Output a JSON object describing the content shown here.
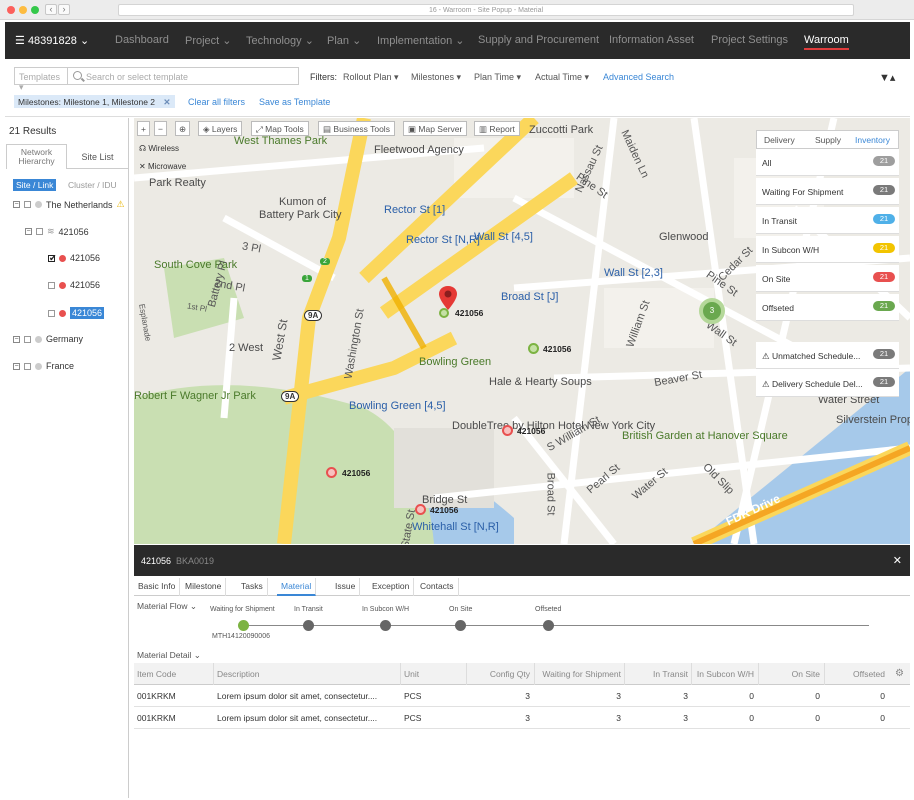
{
  "window": {
    "url_title": "16 - Warroom - Site Popup - Material"
  },
  "topnav": {
    "site_id": "48391828",
    "items": [
      "Dashboard",
      "Project",
      "Technology",
      "Plan",
      "Implementation",
      "Supply and Procurement",
      "Information Asset",
      "Project Settings",
      "Warroom"
    ],
    "active": "Warroom"
  },
  "filterbar": {
    "templates_placeholder": "Templates",
    "search_placeholder": "Search or select template",
    "filters_label": "Filters:",
    "filters": [
      "Rollout Plan",
      "Milestones",
      "Plan Time",
      "Actual Time"
    ],
    "advanced_search": "Advanced Search",
    "chip_label": "Milestones:",
    "chip_value": "Milestone 1, Milestone 2",
    "clear_all": "Clear all filters",
    "save_template": "Save as Template"
  },
  "sidebar": {
    "results": "21 Results",
    "tab_hierarchy": "Network Hierarchy",
    "tab_sitelist": "Site List",
    "seg_active": "Site / Link",
    "seg_other": "Cluster / IDU",
    "tree": {
      "netherlands": "The Netherlands",
      "node_a": "421056",
      "node_b": "421056",
      "node_c": "421056",
      "node_d": "421056",
      "germany": "Germany",
      "france": "France"
    }
  },
  "map": {
    "tools": [
      "Layers",
      "Map Tools",
      "Business Tools",
      "Map Server",
      "Report"
    ],
    "layer_wireless": "Wireless",
    "layer_microwave": "Microwave",
    "markers": {
      "main": "421056",
      "m2": "421056",
      "m3": "421056",
      "m4": "421056",
      "m5": "421056"
    },
    "cluster_count": "3",
    "streets": {
      "rector_st": "Rector St [1]",
      "rector_nr": "Rector St [N,R]",
      "wall_st45": "Wall St [4,5]",
      "wall_st23": "Wall St [2,3]",
      "broad_st_j": "Broad St [J]",
      "bowling_green": "Bowling Green [4,5]",
      "bowling_green_park": "Bowling Green",
      "battery_park": "Battery Park City",
      "kumon": "Kumon of",
      "fleetwood": "Fleetwood Agency",
      "zuccotti": "Zuccotti Park",
      "west_thames": "West Thames Park",
      "park_realty": "Park Realty",
      "south_cove": "South Cove Park",
      "glenwood": "Glenwood",
      "hale_hearty": "Hale & Hearty Soups",
      "doubletree": "DoubleTree by Hilton Hotel New York City",
      "british_garden": "British Garden at Hanover Square",
      "bridge_st": "Bridge St",
      "whitehall": "Whitehall St [N,R]",
      "robert_f": "Robert F Wagner Jr Park",
      "silverstein": "Silverstein Properties",
      "water_street": "Water Street",
      "fdr_drive": "FDR Drive",
      "pine_st": "Pine St",
      "nassau_st": "Nassau St",
      "maiden_ln": "Maiden Ln",
      "william_st": "William St",
      "beaver_st": "Beaver St",
      "s_william_st": "S William St",
      "pearl_st": "Pearl St",
      "water_st": "Water St",
      "old_slip": "Old Slip",
      "broad_st": "Broad St",
      "west_st": "West St",
      "washington_st": "Washington St",
      "battery_pl": "Battery Pl",
      "2nd_pl": "2nd Pl",
      "1st_pl": "1st Pl",
      "3_pl": "3 Pl",
      "2_west": "2 West",
      "cedar_st": "Cedar St",
      "wall_st_label": "Wall St",
      "esplanade": "Esplanade",
      "state_st": "State St",
      "route_9a": "9A",
      "route_1": "1",
      "route_2": "2"
    }
  },
  "inventory": {
    "tabs": [
      "Delivery",
      "Supply",
      "Inventory"
    ],
    "active_tab": "Inventory",
    "rows": [
      {
        "label": "All",
        "count": "21",
        "color": "#9e9e9e"
      },
      {
        "label": "Waiting For Shipment",
        "count": "21",
        "color": "#7a7a7a"
      },
      {
        "label": "In Transit",
        "count": "21",
        "color": "#4fb0e8"
      },
      {
        "label": "In Subcon W/H",
        "count": "21",
        "color": "#f2c400"
      },
      {
        "label": "On Site",
        "count": "21",
        "color": "#e8504f"
      },
      {
        "label": "Offseted",
        "count": "21",
        "color": "#6aa84f"
      }
    ],
    "alerts": [
      {
        "label": "Unmatched Schedule...",
        "count": "21"
      },
      {
        "label": "Delivery Schedule Del...",
        "count": "21"
      }
    ]
  },
  "detail": {
    "site_id": "421056",
    "code": "BKA0019",
    "tabs": [
      "Basic Info",
      "Milestone",
      "Tasks",
      "Material",
      "Issue",
      "Exception",
      "Contacts"
    ],
    "active_tab": "Material",
    "flow_label": "Material Flow",
    "flow_steps": [
      "Waiting for Shipment",
      "In Transit",
      "In Subcon W/H",
      "On Site",
      "Offseted"
    ],
    "flow_sub": "MTH14120090006",
    "detail_label": "Material Detail",
    "columns": [
      "Item Code",
      "Description",
      "Unit",
      "Config Qty",
      "Waiting for Shipment",
      "In Transit",
      "In Subcon W/H",
      "On Site",
      "Offseted"
    ],
    "rows": [
      [
        "001KRKM",
        "Lorem ipsum dolor sit amet, consectetur....",
        "PCS",
        "3",
        "3",
        "3",
        "0",
        "0",
        "0"
      ],
      [
        "001KRKM",
        "Lorem ipsum dolor sit amet, consectetur....",
        "PCS",
        "3",
        "3",
        "3",
        "0",
        "0",
        "0"
      ]
    ]
  }
}
